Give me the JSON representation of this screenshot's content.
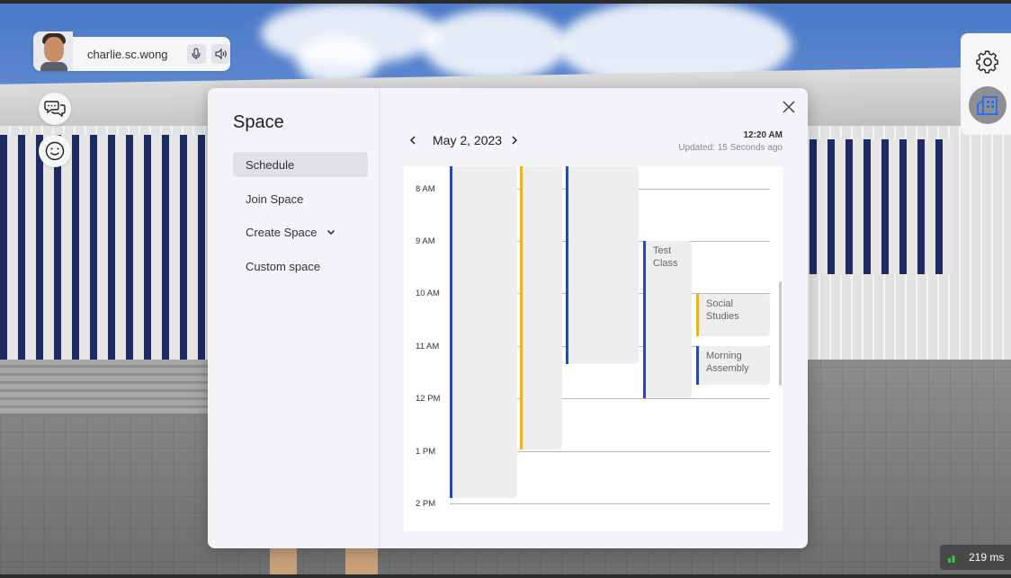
{
  "user": {
    "name": "charlie.sc.wong"
  },
  "sidebar_buttons": [
    {
      "icon": "chat-icon"
    },
    {
      "icon": "smiley-icon"
    }
  ],
  "right_panel": {
    "icons": [
      "gear-icon",
      "building-icon"
    ]
  },
  "modal": {
    "title": "Space",
    "nav": [
      {
        "label": "Schedule",
        "active": true
      },
      {
        "label": "Join Space",
        "active": false
      },
      {
        "label": "Create Space",
        "active": false,
        "has_dropdown": true
      },
      {
        "label": "Custom space",
        "active": false
      }
    ],
    "calendar": {
      "date": "May 2, 2023",
      "time": "12:20 AM",
      "updated": "Updated: 15 Seconds ago",
      "hours": [
        "8 AM",
        "9 AM",
        "10 AM",
        "11 AM",
        "12 PM",
        "1 PM",
        "2 PM"
      ],
      "events": [
        {
          "label": "",
          "color": "#2248c4"
        },
        {
          "label": "",
          "color": "#f4b400"
        },
        {
          "label": "",
          "color": "#2248c4"
        },
        {
          "label": "Test Class",
          "color": "#2248c4"
        },
        {
          "label": "Social Studies",
          "color": "#f4b400"
        },
        {
          "label": "Morning Assembly",
          "color": "#2248c4"
        }
      ]
    }
  },
  "status": {
    "ping": "219 ms"
  },
  "colors": {
    "accent_blue": "#2248c4",
    "accent_yellow": "#f4b400",
    "ping_green": "#3cc43c"
  }
}
